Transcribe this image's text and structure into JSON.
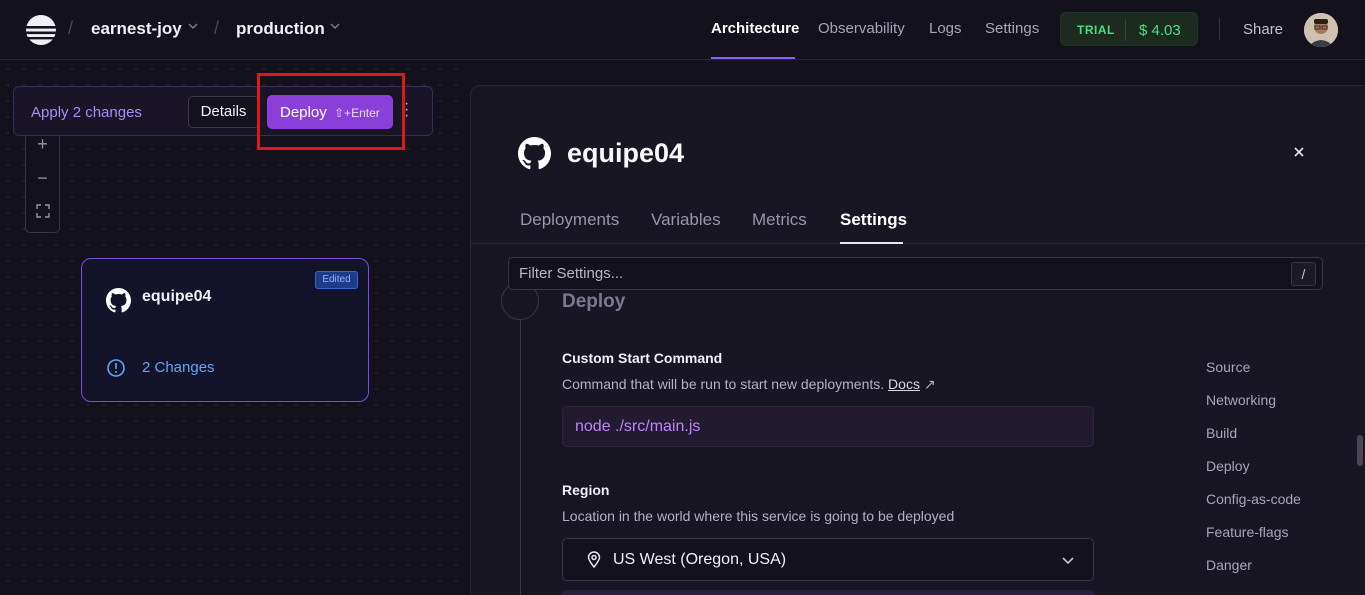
{
  "topbar": {
    "project": "earnest-joy",
    "environment": "production",
    "nav": [
      "Architecture",
      "Observability",
      "Logs",
      "Settings"
    ],
    "trial_label": "TRIAL",
    "credit": "$ 4.03",
    "share": "Share"
  },
  "canvas": {
    "apply_text": "Apply 2 changes",
    "details_label": "Details",
    "deploy_label": "Deploy",
    "deploy_shortcut": "⇧+Enter",
    "zoom": [
      "+",
      "−",
      "⛶"
    ],
    "card": {
      "title": "equipe04",
      "badge": "Edited",
      "changes": "2 Changes"
    }
  },
  "panel": {
    "title": "equipe04",
    "close": "×",
    "tabs": [
      "Deployments",
      "Variables",
      "Metrics",
      "Settings"
    ],
    "active_tab": "Settings",
    "filter_placeholder": "Filter Settings...",
    "filter_shortcut": "/",
    "section": "Deploy",
    "start_command": {
      "label": "Custom Start Command",
      "desc": "Command that will be run to start new deployments.",
      "docs": "Docs",
      "docs_arrow": "↗",
      "value": "node ./src/main.js"
    },
    "region": {
      "label": "Region",
      "desc": "Location in the world where this service is going to be deployed",
      "value": "US West (Oregon, USA)"
    },
    "side_nav": [
      "Source",
      "Networking",
      "Build",
      "Deploy",
      "Config-as-code",
      "Feature-flags",
      "Danger"
    ]
  },
  "colors": {
    "accent": "#8b3fd9",
    "highlight": "#e0161b",
    "trial_green": "#4ade80",
    "link_blue": "#60a5fa"
  },
  "icons": [
    "railway-logo-icon",
    "github-icon",
    "info-icon",
    "map-pin-icon",
    "chevron-down-icon",
    "close-icon",
    "kebab-menu-icon",
    "fullscreen-icon"
  ]
}
